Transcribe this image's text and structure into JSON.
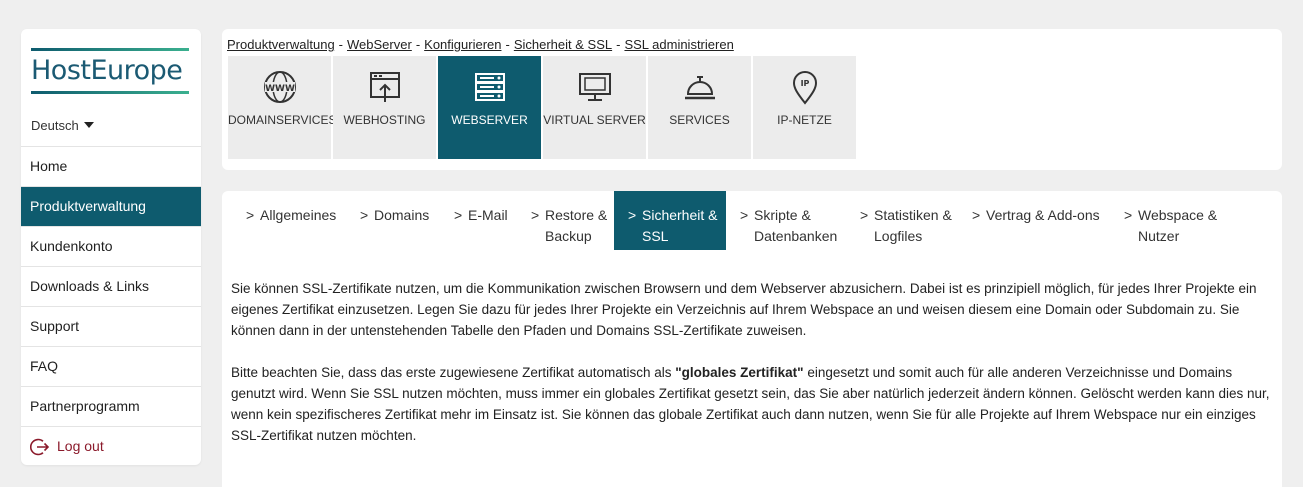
{
  "brand": {
    "name": "HostEurope"
  },
  "sidebar": {
    "language": "Deutsch",
    "items": [
      {
        "label": "Home",
        "active": false
      },
      {
        "label": "Produktverwaltung",
        "active": true
      },
      {
        "label": "Kundenkonto",
        "active": false
      },
      {
        "label": "Downloads & Links",
        "active": false
      },
      {
        "label": "Support",
        "active": false
      },
      {
        "label": "FAQ",
        "active": false
      },
      {
        "label": "Partnerprogramm",
        "active": false
      }
    ],
    "logout_label": "Log out"
  },
  "breadcrumb": [
    "Produktverwaltung",
    "WebServer",
    "Konfigurieren",
    "Sicherheit & SSL",
    "SSL administrieren"
  ],
  "categories": [
    {
      "label": "DOMAINSERVICES",
      "icon": "www-globe-icon",
      "active": false
    },
    {
      "label": "WEBHOSTING",
      "icon": "webhosting-upload-icon",
      "active": false
    },
    {
      "label": "WEBSERVER",
      "icon": "server-rack-icon",
      "active": true
    },
    {
      "label": "VIRTUAL SERVER",
      "icon": "monitor-icon",
      "active": false
    },
    {
      "label": "SERVICES",
      "icon": "service-bell-icon",
      "active": false
    },
    {
      "label": "IP-NETZE",
      "icon": "ip-pin-icon",
      "active": false
    }
  ],
  "subtabs": [
    {
      "line1": "Allgemeines",
      "line2": "",
      "active": false
    },
    {
      "line1": "Domains",
      "line2": "",
      "active": false
    },
    {
      "line1": "E-Mail",
      "line2": "",
      "active": false
    },
    {
      "line1": "Restore &",
      "line2": "Backup",
      "active": false
    },
    {
      "line1": "Sicherheit &",
      "line2": "SSL",
      "active": true
    },
    {
      "line1": "Skripte &",
      "line2": "Datenbanken",
      "active": false
    },
    {
      "line1": "Statistiken &",
      "line2": "Logfiles",
      "active": false
    },
    {
      "line1": "Vertrag & Add-ons",
      "line2": "",
      "active": false
    },
    {
      "line1": "Webspace &",
      "line2": "Nutzer",
      "active": false
    }
  ],
  "content": {
    "paragraph1": "Sie können SSL-Zertifikate nutzen, um die Kommunikation zwischen Browsern und dem Webserver abzusichern. Dabei ist es prinzipiell möglich, für jedes Ihrer Projekte ein eigenes Zertifikat einzusetzen. Legen Sie dazu für jedes Ihrer Projekte ein Verzeichnis auf Ihrem Webspace an und weisen diesem eine Domain oder Subdomain zu. Sie können dann in der untenstehenden Tabelle den Pfaden und Domains SSL-Zertifikate zuweisen.",
    "paragraph2_before": "Bitte beachten Sie, dass das erste zugewiesene Zertifikat automatisch als ",
    "paragraph2_bold": "\"globales Zertifikat\"",
    "paragraph2_after": " eingesetzt und somit auch für alle anderen Verzeichnisse und Domains genutzt wird. Wenn Sie SSL nutzen möchten, muss immer ein globales Zertifikat gesetzt sein, das Sie aber natürlich jederzeit ändern können. Gelöscht werden kann dies nur, wenn kein spezifischeres Zertifikat mehr im Einsatz ist. Sie können das globale Zertifikat auch dann nutzen, wenn Sie für alle Projekte auf Ihrem Webspace nur ein einziges SSL-Zertifikat nutzen möchten."
  },
  "colors": {
    "accent": "#0e5b6e",
    "logout": "#8b1a2b",
    "tile_bg": "#ececec",
    "page_bg": "#efefef"
  }
}
